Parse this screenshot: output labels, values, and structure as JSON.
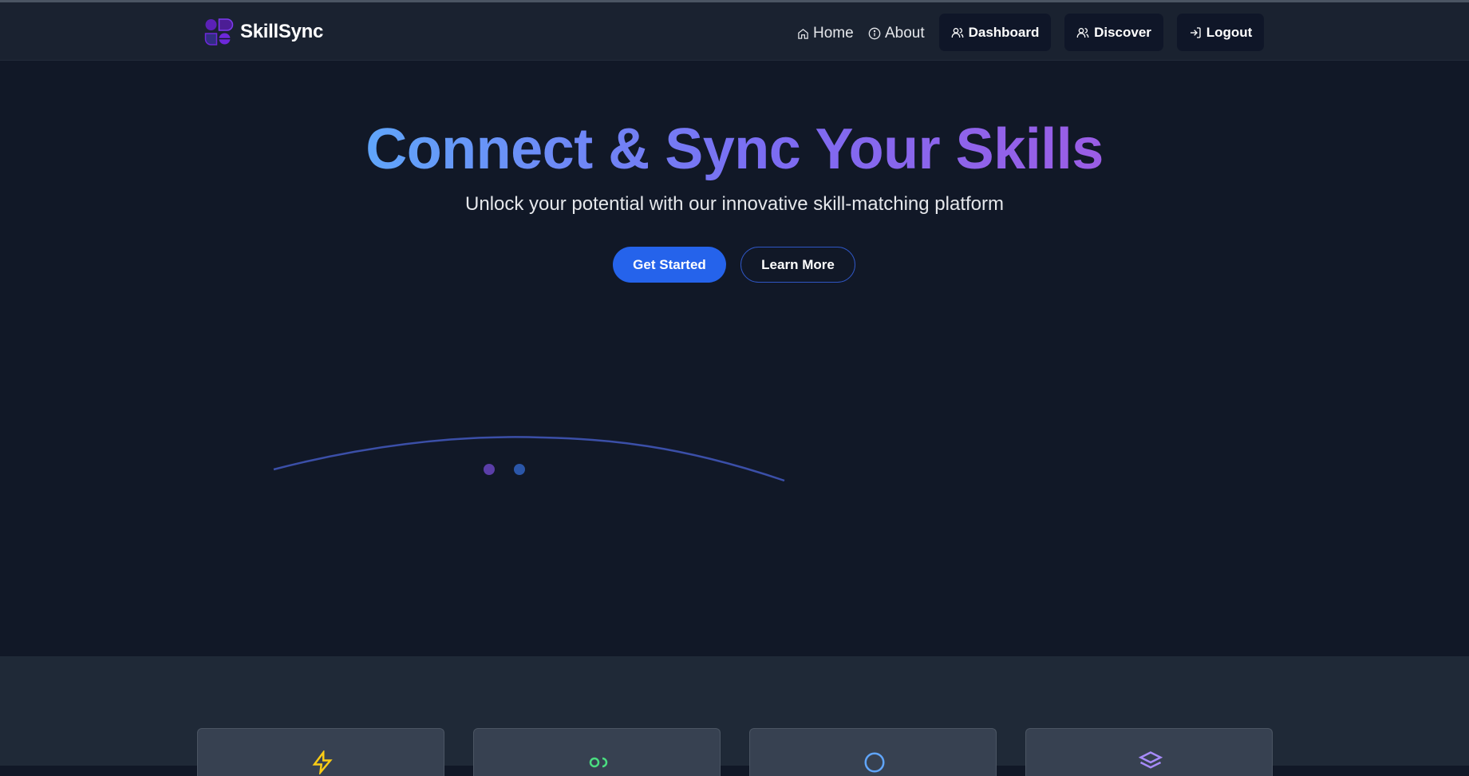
{
  "navbar": {
    "brand": "SkillSync",
    "links": {
      "home": "Home",
      "about": "About"
    },
    "buttons": {
      "dashboard": "Dashboard",
      "discover": "Discover",
      "logout": "Logout"
    }
  },
  "hero": {
    "title": "Connect & Sync Your Skills",
    "subtitle": "Unlock your potential with our innovative skill-matching platform",
    "primary_button": "Get Started",
    "secondary_button": "Learn More"
  },
  "features": {
    "cards": [
      {
        "icon": "lightning-icon",
        "color": "#facc15"
      },
      {
        "icon": "toggle-icon",
        "color": "#4ade80"
      },
      {
        "icon": "circle-icon",
        "color": "#60a5fa"
      },
      {
        "icon": "layers-icon",
        "color": "#a78bfa"
      }
    ]
  },
  "colors": {
    "background": "#111827",
    "navbar": "#1a2230",
    "accent": "#2563eb",
    "title_gradient_start": "#60a5fa",
    "title_gradient_end": "#9b5de5"
  }
}
